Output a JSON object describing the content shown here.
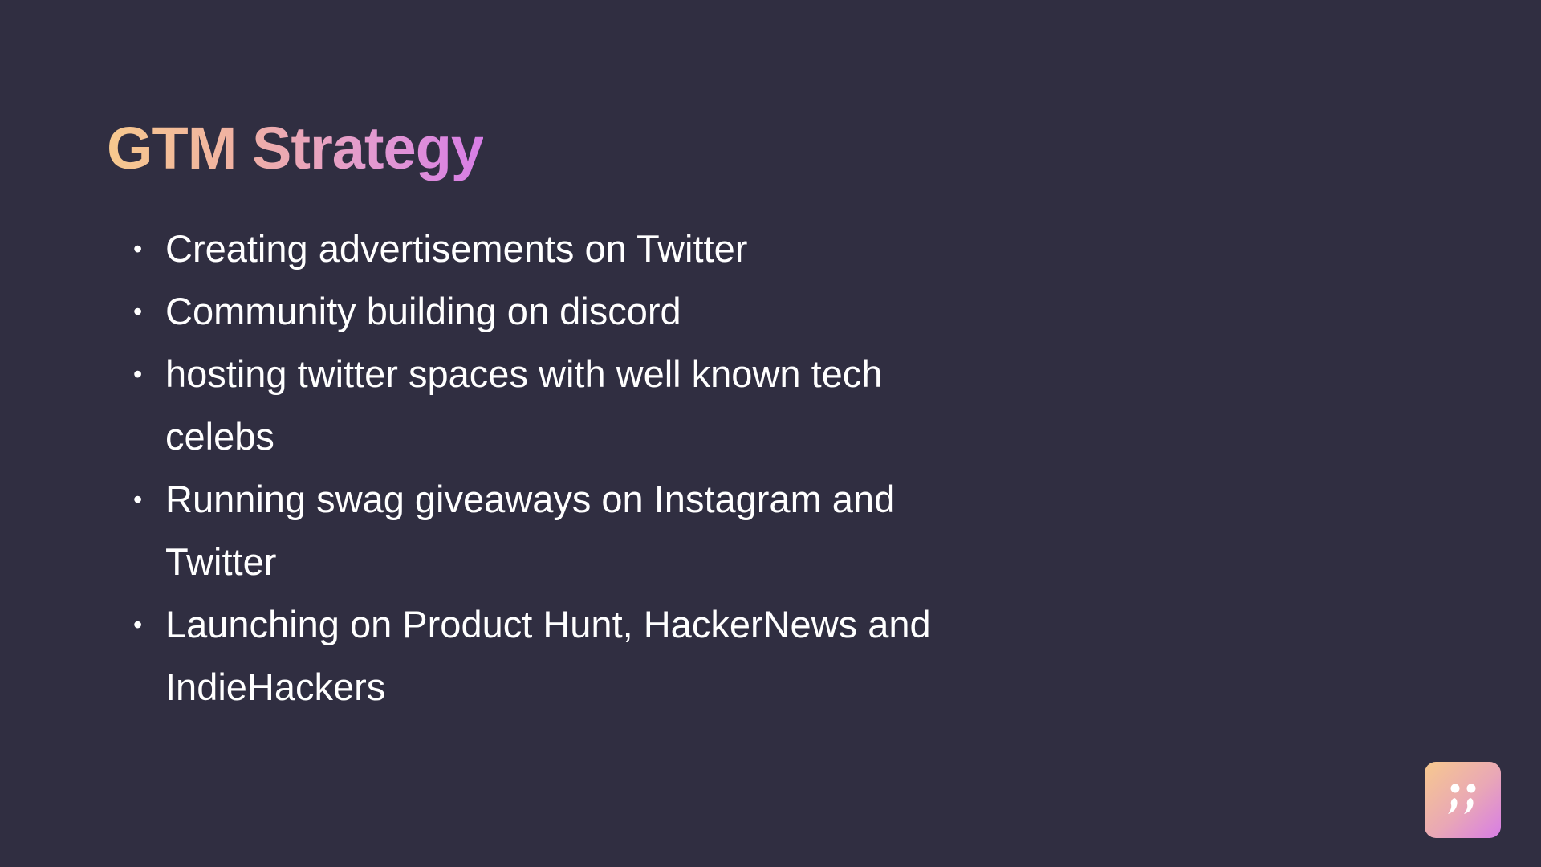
{
  "slide": {
    "title": "GTM Strategy",
    "bullets": [
      "Creating advertisements on Twitter",
      "Community building on discord",
      "hosting twitter spaces with well known tech celebs",
      "Running swag giveaways on Instagram and Twitter",
      "Launching on Product Hunt, HackerNews and IndieHackers"
    ],
    "bullet_symbol": "•"
  },
  "branding": {
    "logo_icon": "quote-logo-icon"
  },
  "colors": {
    "background": "#302e41",
    "title_gradient_start": "#f7c98e",
    "title_gradient_end": "#d77de6",
    "text": "#ffffff"
  }
}
